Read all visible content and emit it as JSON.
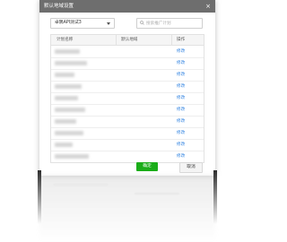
{
  "dialog": {
    "title": "默认地域设置",
    "close_label": "×"
  },
  "toolbar": {
    "account_select": "卓隅API测试3",
    "search_placeholder": "搜索推广计划"
  },
  "table": {
    "columns": [
      "计划名称",
      "默认地域",
      "操作"
    ],
    "rows": [
      {
        "action": "修改",
        "blur_width": 28
      },
      {
        "action": "修改",
        "blur_width": 36
      },
      {
        "action": "修改",
        "blur_width": 22
      },
      {
        "action": "修改",
        "blur_width": 30
      },
      {
        "action": "修改",
        "blur_width": 26
      },
      {
        "action": "修改",
        "blur_width": 34
      },
      {
        "action": "修改",
        "blur_width": 24
      },
      {
        "action": "修改",
        "blur_width": 32
      },
      {
        "action": "修改",
        "blur_width": 20
      },
      {
        "action": "修改",
        "blur_width": 38
      }
    ]
  },
  "footer": {
    "ok_label": "确定",
    "cancel_label": "取消"
  },
  "colors": {
    "titlebar": "#6e6e6e",
    "link": "#2a7fe0",
    "primary": "#1aad19"
  }
}
